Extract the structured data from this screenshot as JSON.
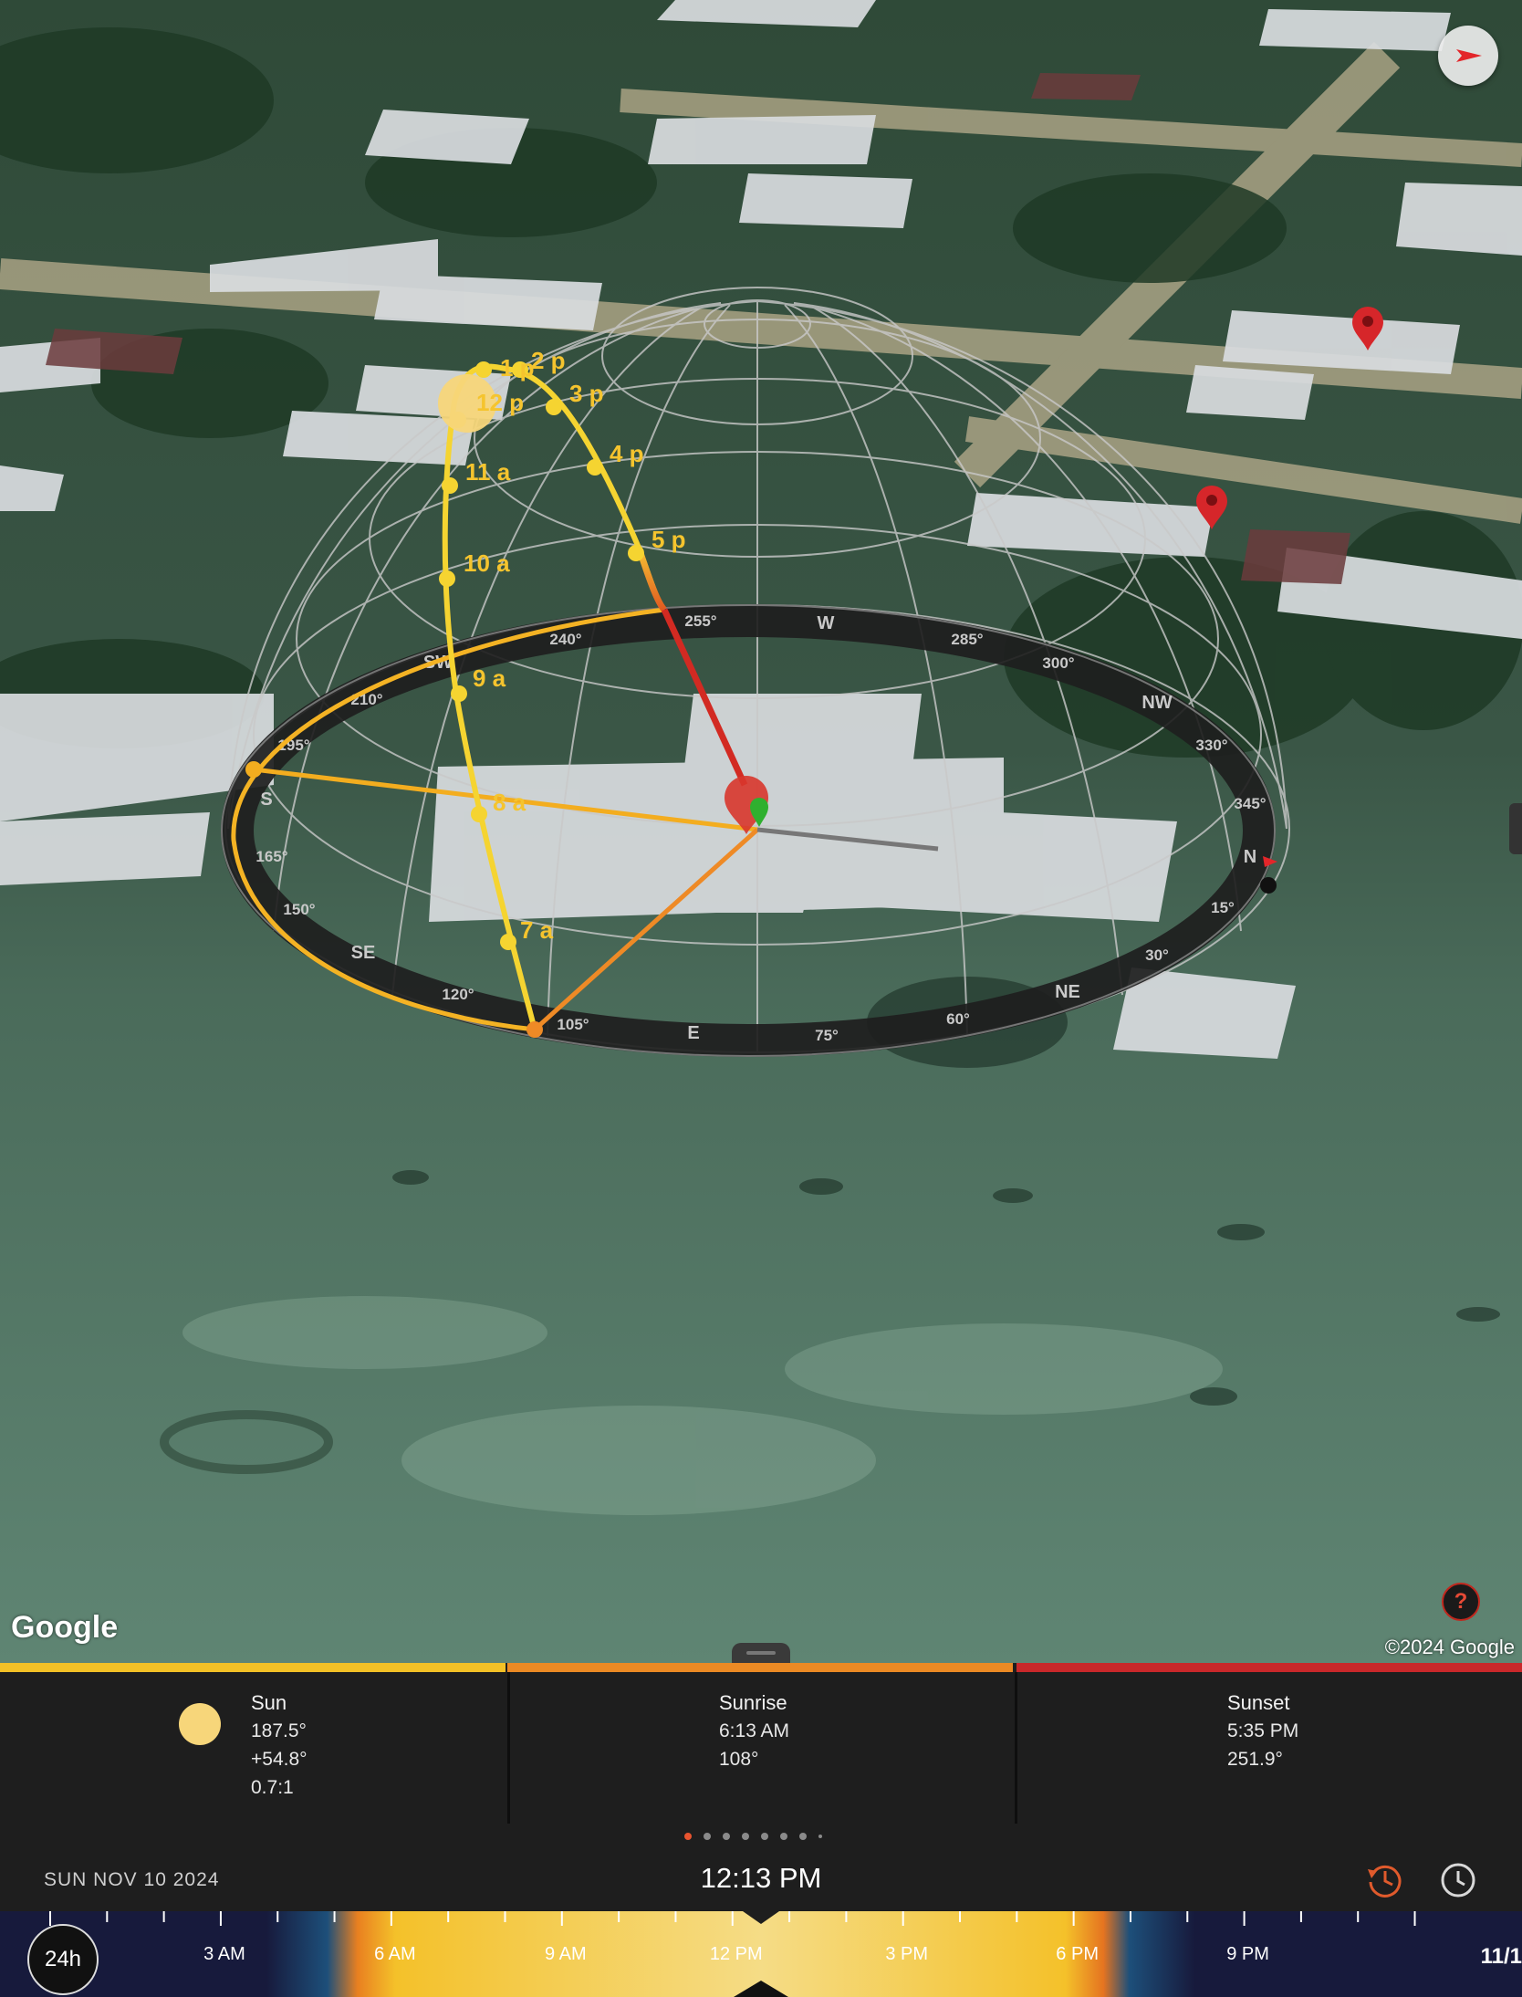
{
  "map": {
    "attribution_logo": "Google",
    "copyright": "©2024 Google",
    "help_label": "?",
    "compass_rose": {
      "cardinals": [
        "N",
        "E",
        "S",
        "W",
        "NE",
        "SE",
        "SW",
        "NW"
      ],
      "degree_ticks": [
        "15°",
        "30°",
        "60°",
        "75°",
        "105°",
        "120°",
        "150°",
        "165°",
        "195°",
        "210°",
        "240°",
        "255°",
        "285°",
        "300°",
        "330°",
        "345°"
      ]
    },
    "sun_path_hour_labels": [
      "7 a",
      "8 a",
      "9 a",
      "10 a",
      "11 a",
      "12 p",
      "1 p",
      "2 p",
      "3 p",
      "4 p",
      "5 p"
    ]
  },
  "info": {
    "sun": {
      "title": "Sun",
      "azimuth": "187.5°",
      "elevation": "+54.8°",
      "ratio": "0.7:1",
      "color": "#f7d67a"
    },
    "sunrise": {
      "title": "Sunrise",
      "time": "6:13 AM",
      "azimuth": "108°"
    },
    "sunset": {
      "title": "Sunset",
      "time": "5:35 PM",
      "azimuth": "251.9°"
    },
    "colors": {
      "sun": "#f3c126",
      "sunrise": "#eb8a24",
      "sunset": "#c9282a"
    }
  },
  "datebar": {
    "date": "SUN NOV 10 2024",
    "time": "12:13 PM",
    "page_count": 8,
    "active_page": 1,
    "reset_icon": "history-icon",
    "clock_icon": "clock-icon"
  },
  "timeline": {
    "mode_label": "24h",
    "hour_labels": [
      "3 AM",
      "6 AM",
      "9 AM",
      "12 PM",
      "3 PM",
      "6 PM",
      "9 PM"
    ],
    "edge_label": "11/1"
  }
}
